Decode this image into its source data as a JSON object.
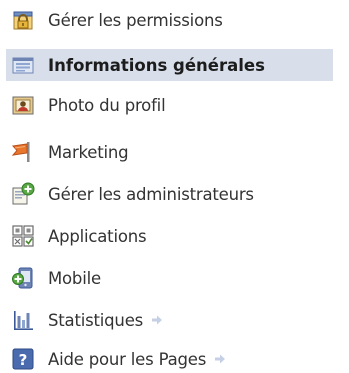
{
  "menu": {
    "items": [
      {
        "label": "Gérer les permissions",
        "icon": "padlock-icon",
        "selected": false,
        "arrow": false
      },
      {
        "label": "Informations générales",
        "icon": "info-card-icon",
        "selected": true,
        "arrow": false
      },
      {
        "label": "Photo du profil",
        "icon": "profile-photo-icon",
        "selected": false,
        "arrow": false
      },
      {
        "label": "Marketing",
        "icon": "marketing-flag-icon",
        "selected": false,
        "arrow": false
      },
      {
        "label": "Gérer les administrateurs",
        "icon": "add-admin-icon",
        "selected": false,
        "arrow": false
      },
      {
        "label": "Applications",
        "icon": "applications-grid-icon",
        "selected": false,
        "arrow": false
      },
      {
        "label": "Mobile",
        "icon": "mobile-phone-icon",
        "selected": false,
        "arrow": false
      },
      {
        "label": "Statistiques",
        "icon": "statistics-bars-icon",
        "selected": false,
        "arrow": true
      },
      {
        "label": "Aide pour les Pages",
        "icon": "help-question-icon",
        "selected": false,
        "arrow": true
      }
    ],
    "colors": {
      "selected_bg": "#d8dfea",
      "text": "#333333",
      "arrow": "#c5d0e6"
    }
  }
}
